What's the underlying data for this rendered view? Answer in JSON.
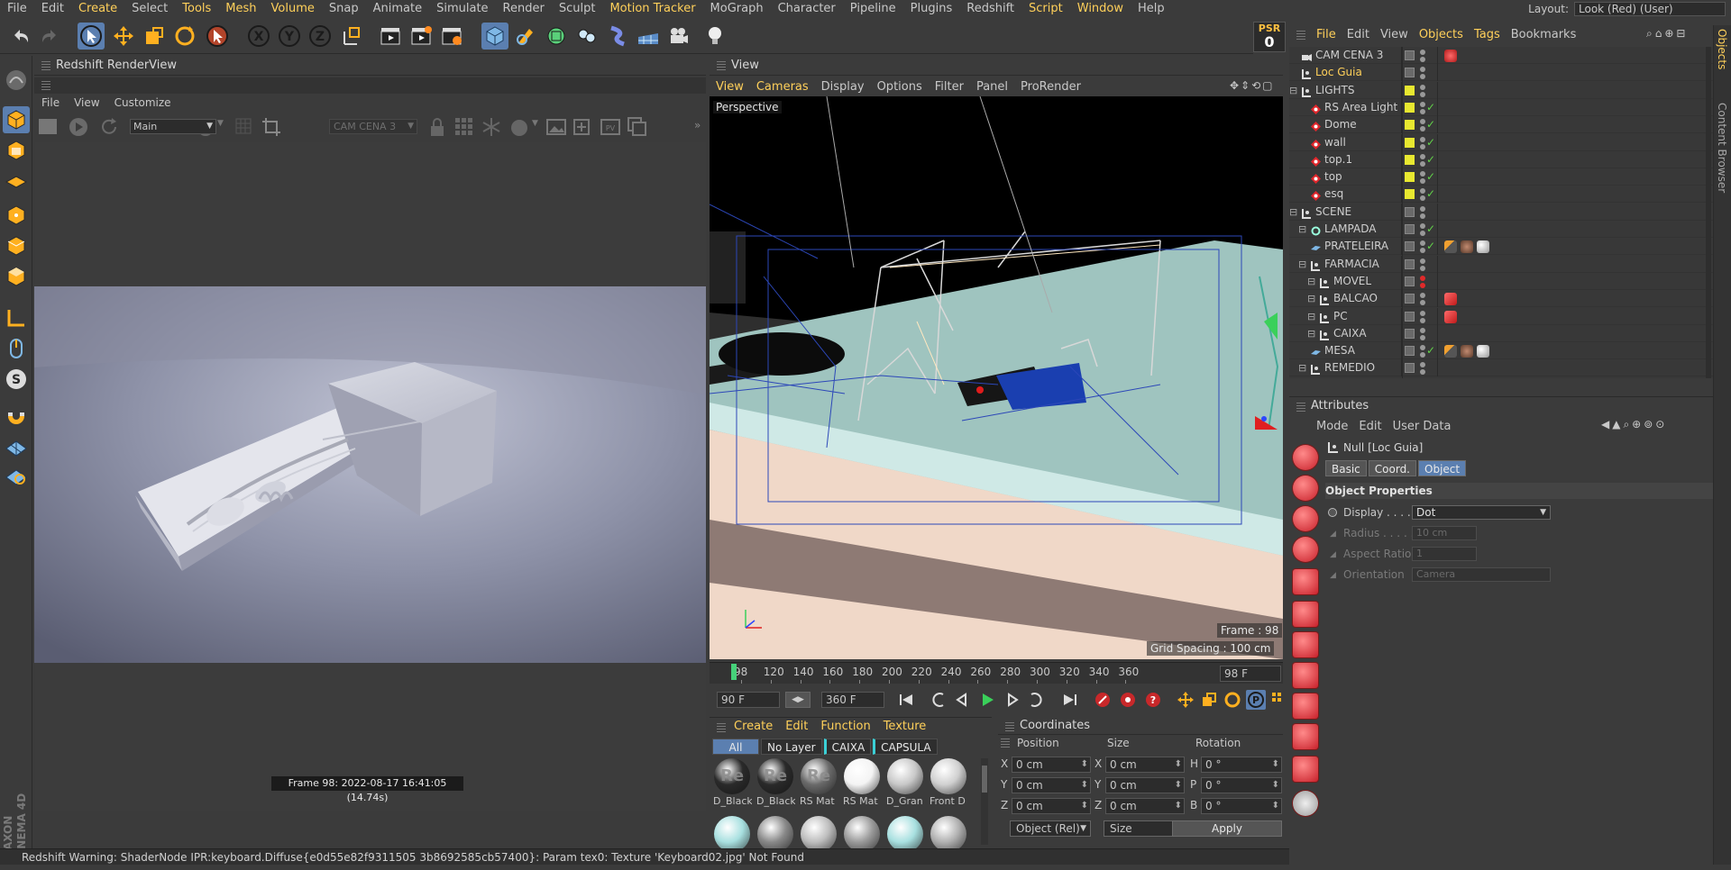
{
  "menubar": {
    "items": [
      "File",
      "Edit",
      "Create",
      "Select",
      "Tools",
      "Mesh",
      "Volume",
      "Snap",
      "Animate",
      "Simulate",
      "Render",
      "Sculpt",
      "Motion Tracker",
      "MoGraph",
      "Character",
      "Pipeline",
      "Plugins",
      "Redshift",
      "Script",
      "Window",
      "Help"
    ],
    "highlight": [
      "Create",
      "Tools",
      "Mesh",
      "Volume",
      "Motion Tracker",
      "Script",
      "Window"
    ],
    "layout_label": "Layout:",
    "layout_value": "Look (Red) (User)"
  },
  "psr": {
    "label": "PSR",
    "value": "0"
  },
  "toolbar": {
    "icons": [
      "undo-icon",
      "redo-icon",
      "select-arrow-icon",
      "move-icon",
      "scale-icon",
      "rotate-icon",
      "live-select-icon",
      "x-axis-icon",
      "y-axis-icon",
      "z-axis-icon",
      "coordinate-system-icon",
      "render-view-icon",
      "render-active-icon",
      "render-settings-icon",
      "cube-icon",
      "pen-icon",
      "subdivision-icon",
      "array-icon",
      "deformer-icon",
      "floor-icon",
      "camera-icon",
      "light-icon"
    ],
    "axis_labels": [
      "X",
      "Y",
      "Z"
    ]
  },
  "renderview": {
    "title": "Redshift RenderView",
    "menu": [
      "File",
      "View",
      "Customize"
    ],
    "aov": "Main",
    "camera": "CAM CENA 3",
    "caption": "Frame 98:  2022-08-17  16:41:05  (14.74s)"
  },
  "viewport": {
    "title": "View",
    "menu": [
      "View",
      "Cameras",
      "Display",
      "Options",
      "Filter",
      "Panel",
      "ProRender"
    ],
    "menu_highlight": [
      "View",
      "Cameras"
    ],
    "mode": "Perspective",
    "frame": "Frame : 98",
    "grid_spacing": "Grid Spacing : 100 cm"
  },
  "timeline": {
    "ticks": [
      "98",
      "120",
      "140",
      "160",
      "180",
      "200",
      "220",
      "240",
      "260",
      "280",
      "300",
      "320",
      "340",
      "360"
    ],
    "current": "98 F",
    "start": "90 F",
    "end": "360 F"
  },
  "materials": {
    "menu": [
      "Create",
      "Edit",
      "Function",
      "Texture"
    ],
    "layers": [
      "All",
      "No Layer",
      "CAIXA",
      "CAPSULA"
    ],
    "row1": [
      {
        "name": "D_Black",
        "color": "#2a2a2a",
        "tag": "Re"
      },
      {
        "name": "D_Black",
        "color": "#2a2a2a",
        "tag": "Re"
      },
      {
        "name": "RS Mat",
        "color": "#6a6a6a",
        "tag": "Re"
      },
      {
        "name": "RS Mat",
        "color": "#f4f4f4",
        "tag": ""
      },
      {
        "name": "D_Gran",
        "color": "#c8c8c8",
        "tag": ""
      },
      {
        "name": "Front D",
        "color": "#d0d0d0",
        "tag": ""
      }
    ],
    "row2": [
      {
        "name": "",
        "color": "#a8e0e0"
      },
      {
        "name": "",
        "color": "#888888"
      },
      {
        "name": "",
        "color": "#bdbdbd"
      },
      {
        "name": "",
        "color": "#9a9a9a"
      },
      {
        "name": "",
        "color": "#a8e0e0"
      },
      {
        "name": "",
        "color": "#b0b0b0"
      }
    ]
  },
  "coordinates": {
    "title": "Coordinates",
    "headers": [
      "Position",
      "Size",
      "Rotation"
    ],
    "rows": [
      {
        "axis": "X",
        "pos": "0 cm",
        "size_axis": "X",
        "size": "0 cm",
        "rot_axis": "H",
        "rot": "0 °"
      },
      {
        "axis": "Y",
        "pos": "0 cm",
        "size_axis": "Y",
        "size": "0 cm",
        "rot_axis": "P",
        "rot": "0 °"
      },
      {
        "axis": "Z",
        "pos": "0 cm",
        "size_axis": "Z",
        "size": "0 cm",
        "rot_axis": "B",
        "rot": "0 °"
      }
    ],
    "mode": "Object (Rel)",
    "size_mode": "Size",
    "apply": "Apply"
  },
  "objects": {
    "menu": [
      "File",
      "Edit",
      "View",
      "Objects",
      "Tags",
      "Bookmarks"
    ],
    "menu_highlight": [
      "File",
      "Objects",
      "Tags"
    ],
    "rows": [
      {
        "name": "CAM CENA 3",
        "depth": 0,
        "icon": "camera",
        "color": "#cfcfcf",
        "lightsq": false,
        "check": false,
        "tags": [
          "render"
        ]
      },
      {
        "name": "Loc Guia",
        "depth": 0,
        "icon": "null",
        "color": "#ffd05a",
        "lightsq": false,
        "check": false,
        "tags": []
      },
      {
        "name": "LIGHTS",
        "depth": 0,
        "icon": "null",
        "color": "#cfcfcf",
        "lightsq": true,
        "check": false,
        "tags": [],
        "expand": true
      },
      {
        "name": "RS Area Light",
        "depth": 1,
        "icon": "rslight",
        "color": "#cfcfcf",
        "lightsq": true,
        "check": true,
        "tags": []
      },
      {
        "name": "Dome",
        "depth": 1,
        "icon": "rslight",
        "color": "#cfcfcf",
        "lightsq": true,
        "check": true,
        "tags": []
      },
      {
        "name": "wall",
        "depth": 1,
        "icon": "rslight",
        "color": "#cfcfcf",
        "lightsq": true,
        "check": true,
        "tags": []
      },
      {
        "name": "top.1",
        "depth": 1,
        "icon": "rslight",
        "color": "#cfcfcf",
        "lightsq": true,
        "check": true,
        "tags": []
      },
      {
        "name": "top",
        "depth": 1,
        "icon": "rslight",
        "color": "#cfcfcf",
        "lightsq": true,
        "check": true,
        "tags": []
      },
      {
        "name": "esq",
        "depth": 1,
        "icon": "rslight",
        "color": "#cfcfcf",
        "lightsq": true,
        "check": true,
        "tags": []
      },
      {
        "name": "SCENE",
        "depth": 0,
        "icon": "null",
        "color": "#cfcfcf",
        "lightsq": false,
        "check": false,
        "tags": [],
        "expand": true
      },
      {
        "name": "LAMPADA",
        "depth": 1,
        "icon": "gear",
        "color": "#cfcfcf",
        "lightsq": false,
        "check": true,
        "tags": [],
        "expand": true
      },
      {
        "name": "PRATELEIRA",
        "depth": 1,
        "icon": "plane",
        "color": "#cfcfcf",
        "lightsq": false,
        "check": true,
        "tags": [
          "phong",
          "wood",
          "sphere"
        ]
      },
      {
        "name": "FARMACIA",
        "depth": 1,
        "icon": "null",
        "color": "#cfcfcf",
        "lightsq": false,
        "check": false,
        "tags": [],
        "expand": true
      },
      {
        "name": "MOVEL",
        "depth": 2,
        "icon": "null",
        "color": "#cfcfcf",
        "lightsq": false,
        "check": false,
        "tags": [],
        "expand": true,
        "red": true
      },
      {
        "name": "BALCAO",
        "depth": 2,
        "icon": "null",
        "color": "#cfcfcf",
        "lightsq": false,
        "check": false,
        "tags": [
          "redcube"
        ],
        "expand": true
      },
      {
        "name": "PC",
        "depth": 2,
        "icon": "null",
        "color": "#cfcfcf",
        "lightsq": false,
        "check": false,
        "tags": [
          "redcube"
        ],
        "expand": true
      },
      {
        "name": "CAIXA",
        "depth": 2,
        "icon": "null",
        "color": "#cfcfcf",
        "lightsq": false,
        "check": false,
        "tags": [],
        "expand": true
      },
      {
        "name": "MESA",
        "depth": 1,
        "icon": "plane",
        "color": "#cfcfcf",
        "lightsq": false,
        "check": true,
        "tags": [
          "phong",
          "wood",
          "sphere"
        ]
      },
      {
        "name": "REMEDIO",
        "depth": 1,
        "icon": "null",
        "color": "#cfcfcf",
        "lightsq": false,
        "check": false,
        "tags": [],
        "expand": true
      }
    ]
  },
  "right_tabs": [
    "Objects",
    "Content Browser"
  ],
  "attributes": {
    "title": "Attributes",
    "menu": [
      "Mode",
      "Edit",
      "User Data"
    ],
    "object": "Null [Loc Guia]",
    "tabs": [
      "Basic",
      "Coord.",
      "Object"
    ],
    "active_tab": "Object",
    "section": "Object Properties",
    "display_label": "Display . . . . .",
    "display_value": "Dot",
    "radius_label": "Radius . . . . .",
    "radius_value": "10 cm",
    "aspect_label": "Aspect Ratio",
    "aspect_value": "1",
    "orientation_label": "Orientation",
    "orientation_value": "Camera"
  },
  "status": "Redshift Warning: ShaderNode IPR:keyboard.Diffuse{e0d55e82f9311505 3b8692585cb57400}: Param tex0: Texture 'Keyboard02.jpg' Not Found",
  "colors": {
    "accent": "#5b7fb0",
    "highlight": "#ffd05a",
    "panel": "#3b3b3b",
    "dark": "#2c2c2c"
  }
}
